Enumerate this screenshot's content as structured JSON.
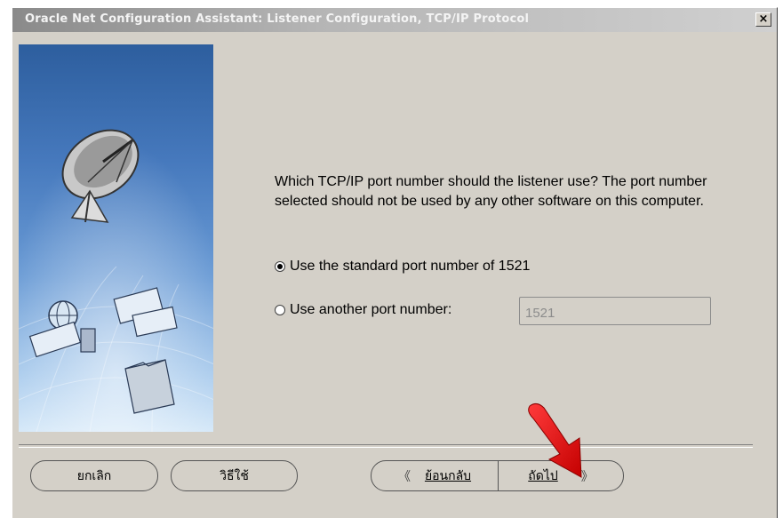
{
  "window": {
    "title": "Oracle Net Configuration Assistant: Listener Configuration, TCP/IP Protocol",
    "close_label": "×"
  },
  "main": {
    "question": "Which TCP/IP port number should the listener use? The port number selected should not be used by any other software on this computer.",
    "option_standard": "Use the standard port number of 1521",
    "option_other": "Use another port number:",
    "port_value": "1521"
  },
  "buttons": {
    "cancel": "ยกเลิก",
    "help": "วิธีใช้",
    "back": "ย้อนกลับ",
    "next": "ถัดไป"
  },
  "colors": {
    "dialog_bg": "#d4d0c8",
    "panel_top": "#2d5e9e",
    "annotation_arrow": "#e4141b"
  },
  "icons": [
    "satellite-dish-icon",
    "globe-icon",
    "network-cards-icon",
    "folder-icon",
    "back-chevron-icon",
    "next-chevron-icon",
    "red-arrow-annotation"
  ]
}
